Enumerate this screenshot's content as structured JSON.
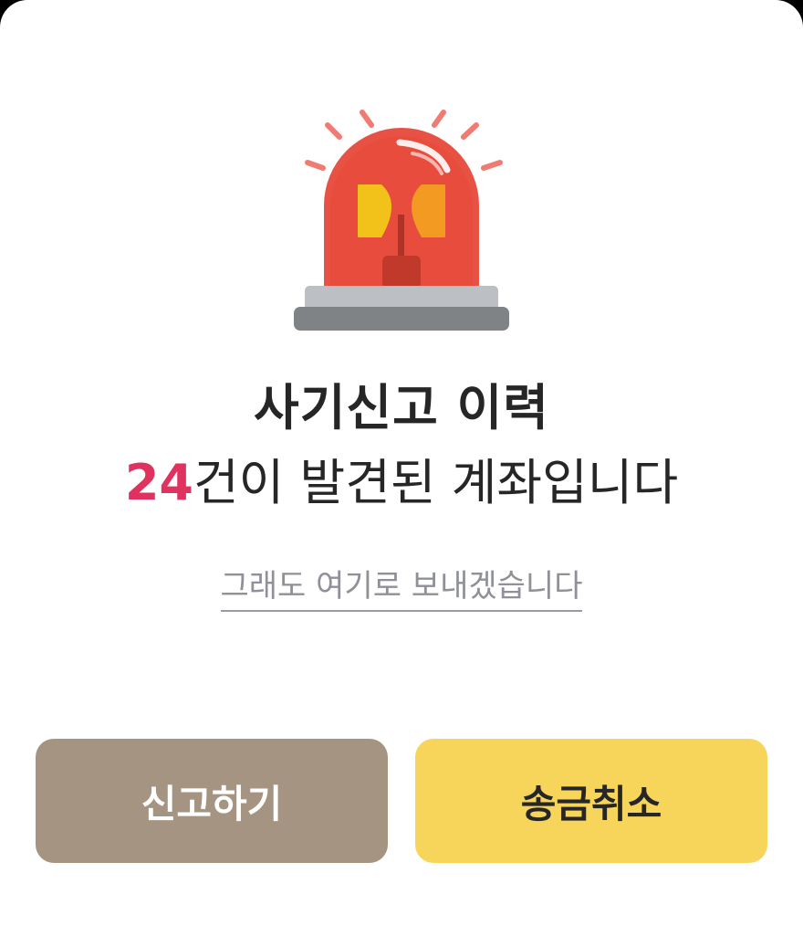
{
  "dialog": {
    "icon": "siren-icon",
    "title": "사기신고 이력",
    "message_count": "24",
    "message_rest": "건이 발견된 계좌입니다",
    "send_anyway_link": "그래도 여기로 보내겠습니다",
    "buttons": {
      "report_label": "신고하기",
      "cancel_label": "송금취소"
    }
  },
  "colors": {
    "accent_red": "#e0325f",
    "report_button": "#a69482",
    "cancel_button": "#f7d45a",
    "text": "#262626",
    "link": "#8f9099"
  }
}
